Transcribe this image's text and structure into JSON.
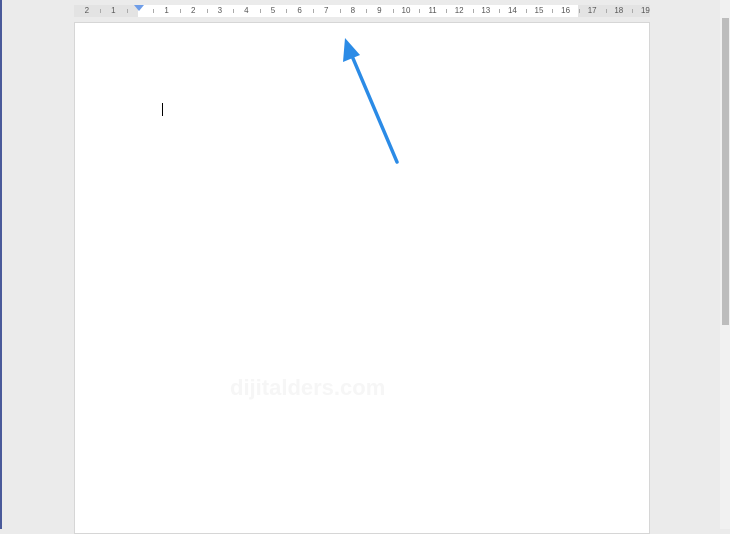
{
  "ruler": {
    "labels_left": [
      "2",
      "1"
    ],
    "labels_right": [
      "1",
      "2",
      "3",
      "4",
      "5",
      "6",
      "7",
      "8",
      "9",
      "10",
      "11",
      "12",
      "13",
      "14",
      "15",
      "16",
      "17",
      "18",
      "19"
    ]
  },
  "document": {
    "watermark": "dijitalders.com"
  },
  "colors": {
    "arrow": "#2b8be6",
    "indent_marker": "#6e9de8"
  }
}
